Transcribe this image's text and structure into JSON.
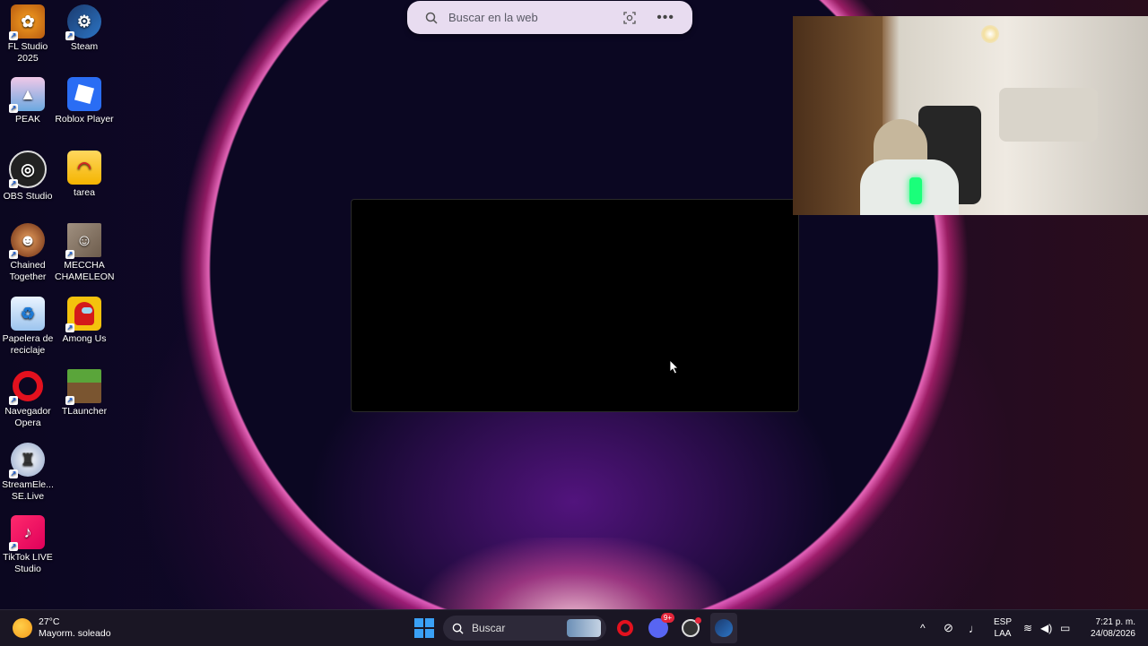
{
  "search": {
    "placeholder": "Buscar en la web"
  },
  "desktop_icons": [
    {
      "label": "FL Studio 2025",
      "icon": "fl-studio-icon"
    },
    {
      "label": "Steam",
      "icon": "steam-icon"
    },
    {
      "label": "PEAK",
      "icon": "peak-icon"
    },
    {
      "label": "Roblox Player",
      "icon": "roblox-icon"
    },
    {
      "label": "OBS Studio",
      "icon": "obs-icon"
    },
    {
      "label": "tarea",
      "icon": "folder-icon"
    },
    {
      "label": "Chained Together",
      "icon": "chained-together-icon"
    },
    {
      "label": "MECCHA CHAMELEON",
      "icon": "meccha-chameleon-icon"
    },
    {
      "label": "Papelera de reciclaje",
      "icon": "recycle-bin-icon"
    },
    {
      "label": "Among Us",
      "icon": "among-us-icon"
    },
    {
      "label": "Navegador Opera",
      "icon": "opera-icon"
    },
    {
      "label": "TLauncher",
      "icon": "tlauncher-icon"
    },
    {
      "label": "StreamEle... SE.Live",
      "icon": "streamelements-icon"
    },
    {
      "label": "TikTok LIVE Studio",
      "icon": "tiktok-live-icon"
    }
  ],
  "weather": {
    "temp": "27°C",
    "desc": "Mayorm. soleado"
  },
  "taskbar": {
    "search_label": "Buscar",
    "discord_badge": "9+",
    "lang": "ESP",
    "layout": "LAA",
    "time": "7:21 p. m.",
    "date": "24/08/2026"
  },
  "colors": {
    "accent": "#0078d4",
    "taskbar": "#1a1624",
    "search_bg": "#e8dcf0"
  }
}
